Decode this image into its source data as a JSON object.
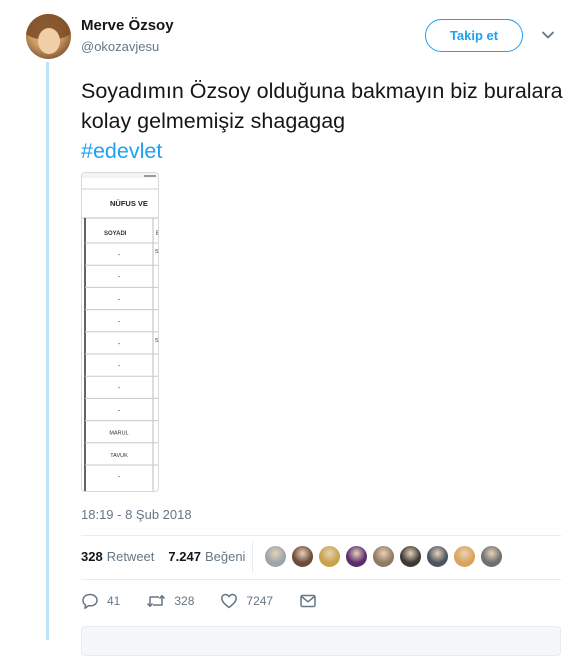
{
  "author": {
    "name": "Merve Özsoy",
    "handle": "@okozavjesu"
  },
  "follow_label": "Takip et",
  "tweet": {
    "text": "Soyadımın Özsoy olduğuna bakmayın biz buralara kolay gelmemişiz shagagag",
    "hashtag": "#edevlet"
  },
  "media": {
    "header": "NÜFUS VE",
    "column": "SOYADI",
    "column2_prefix": "E",
    "rows": [
      "-",
      "-",
      "-",
      "-",
      "-",
      "-",
      "-",
      "-",
      "MARUL",
      "TAVUK",
      "-"
    ],
    "side_marks": [
      "S",
      "",
      "",
      "",
      "S",
      "",
      "",
      "",
      "",
      "",
      ""
    ]
  },
  "timestamp": "18:19 - 8 Şub 2018",
  "stats": {
    "retweets_count": "328",
    "retweets_label": "Retweet",
    "likes_count": "7.247",
    "likes_label": "Beğeni"
  },
  "likers": [
    "#9aa5ae",
    "#6b4b3a",
    "#c9a24a",
    "#5a2d6e",
    "#8f7a62",
    "#3d3a35",
    "#4a5560",
    "#d9a35c",
    "#6f6f6f"
  ],
  "actions": {
    "replies": "41",
    "retweets": "328",
    "likes": "7247"
  },
  "colors": {
    "accent": "#1da1f2",
    "muted": "#657786",
    "thread_line": "#bfe3f7"
  }
}
